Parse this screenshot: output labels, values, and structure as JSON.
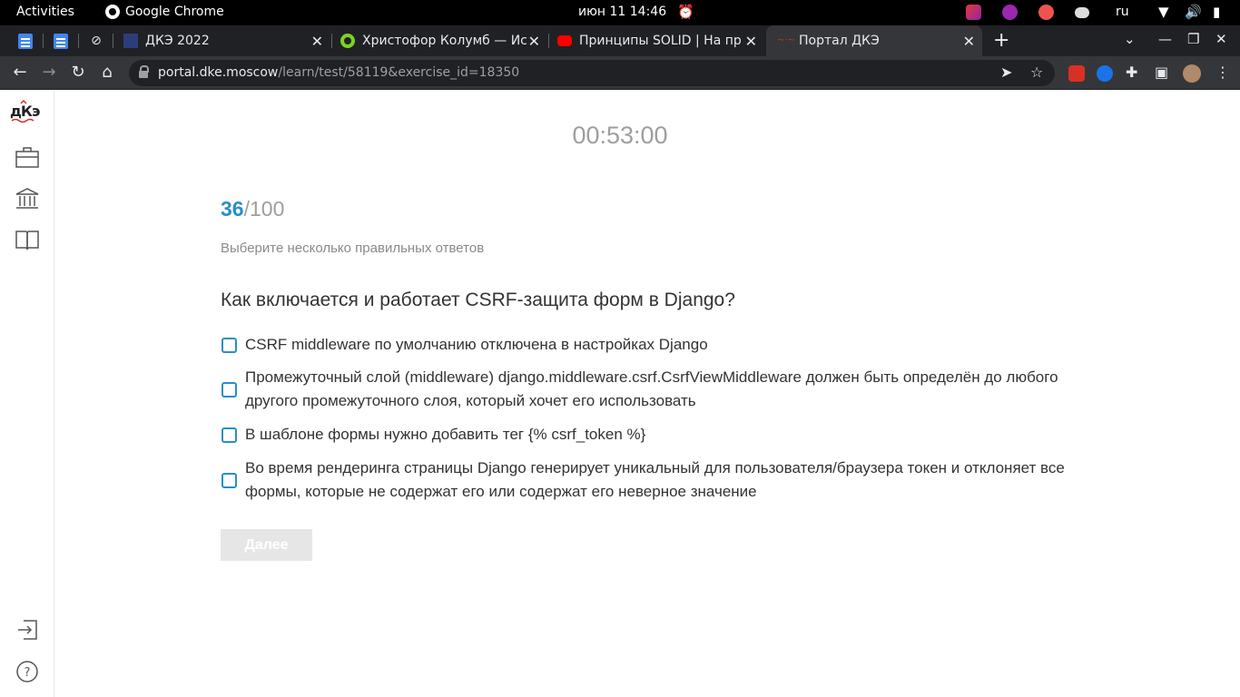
{
  "os_bar": {
    "activities": "Activities",
    "app_name": "Google Chrome",
    "clock": "июн 11  14:46",
    "keyboard_layout": "ru"
  },
  "tabs": [
    {
      "title": "ДКЭ 2022"
    },
    {
      "title": "Христофор Колумб — Ис"
    },
    {
      "title": "Принципы SOLID | На пр"
    },
    {
      "title": "Портал ДКЭ"
    }
  ],
  "address_bar": {
    "host": "portal.dke.moscow",
    "path": "/learn/test/58119&exercise_id=18350"
  },
  "sidebar": {
    "logo_top": "дКэ"
  },
  "quiz": {
    "timer": "00:53:00",
    "current": "36",
    "total": "/100",
    "instruction": "Выберите несколько правильных ответов",
    "question": "Как включается и работает CSRF-защита форм в Django?",
    "options": [
      "CSRF middleware по умолчанию отключена в настройках Django",
      "Промежуточный слой (middleware) django.middleware.csrf.CsrfViewMiddleware должен быть определён до любого другого промежуточного слоя, который хочет его использовать",
      "В шаблоне формы нужно добавить тег {% csrf_token %}",
      "Во время рендеринга страницы Django генерирует уникальный для пользователя/браузера токен и отклоняет все формы, которые не содержат его или содержат его неверное значение"
    ],
    "next_label": "Далее"
  },
  "colors": {
    "accent": "#2a8ec7",
    "disabled_button": "#e6e6e6"
  }
}
